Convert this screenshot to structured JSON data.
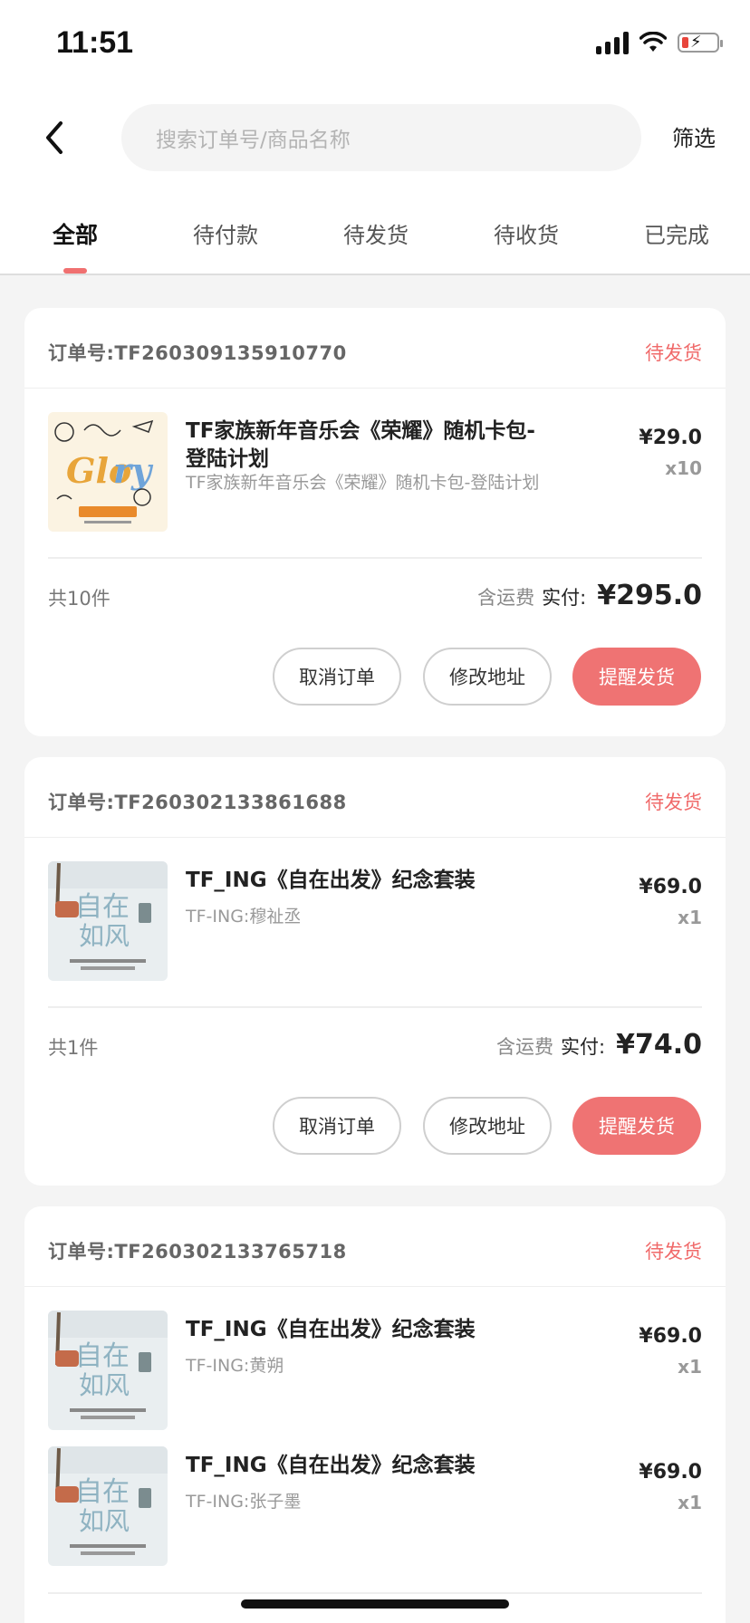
{
  "status_bar": {
    "time": "11:51"
  },
  "header": {
    "search_placeholder": "搜索订单号/商品名称",
    "filter_label": "筛选"
  },
  "tabs": [
    {
      "label": "全部",
      "active": true
    },
    {
      "label": "待付款"
    },
    {
      "label": "待发货"
    },
    {
      "label": "待收货"
    },
    {
      "label": "已完成"
    }
  ],
  "orders": [
    {
      "order_no": "订单号:TF260309135910770",
      "status": "待发货",
      "items": [
        {
          "title": "TF家族新年音乐会《荣耀》随机卡包-登陆计划",
          "subtitle": "TF家族新年音乐会《荣耀》随机卡包-登陆计划",
          "price": "¥29.0",
          "qty": "x10"
        }
      ],
      "count": "共10件",
      "shipping_label": "含运费",
      "paid_label": "实付:",
      "total": "¥295.0",
      "buttons": {
        "cancel": "取消订单",
        "modify": "修改地址",
        "remind": "提醒发货"
      }
    },
    {
      "order_no": "订单号:TF260302133861688",
      "status": "待发货",
      "items": [
        {
          "title": "TF_ING《自在出发》纪念套装",
          "subtitle": "TF-ING:穆祉丞",
          "price": "¥69.0",
          "qty": "x1"
        }
      ],
      "count": "共1件",
      "shipping_label": "含运费",
      "paid_label": "实付:",
      "total": "¥74.0",
      "buttons": {
        "cancel": "取消订单",
        "modify": "修改地址",
        "remind": "提醒发货"
      }
    },
    {
      "order_no": "订单号:TF260302133765718",
      "status": "待发货",
      "items": [
        {
          "title": "TF_ING《自在出发》纪念套装",
          "subtitle": "TF-ING:黄朔",
          "price": "¥69.0",
          "qty": "x1"
        },
        {
          "title": "TF_ING《自在出发》纪念套装",
          "subtitle": "TF-ING:张子墨",
          "price": "¥69.0",
          "qty": "x1"
        }
      ]
    }
  ],
  "colors": {
    "accent": "#ef7373",
    "status_text": "#f06a6a",
    "background": "#f4f4f4"
  },
  "icons": {
    "back": "chevron-left-icon",
    "signal": "cellular-signal-icon",
    "wifi": "wifi-icon",
    "battery": "battery-charging-icon"
  }
}
